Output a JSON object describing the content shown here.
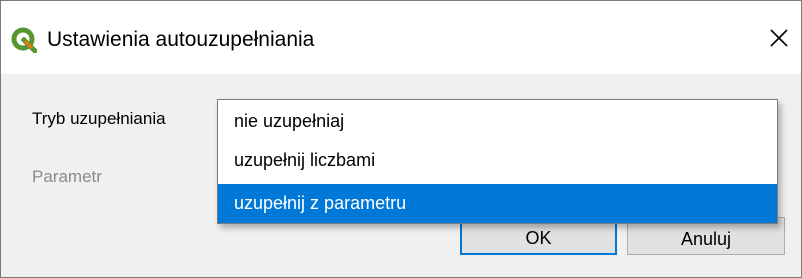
{
  "window": {
    "title": "Ustawienia autouzupełniania",
    "icon": "qgis-logo-icon",
    "close_icon": "close-icon"
  },
  "form": {
    "mode_label": "Tryb uzupełniania",
    "param_label": "Parametr"
  },
  "dropdown": {
    "options": [
      "nie uzupełniaj",
      "uzupełnij liczbami",
      "uzupełnij z parametru"
    ],
    "highlighted": "uzupełnij z parametru"
  },
  "buttons": {
    "ok": "OK",
    "cancel": "Anuluj"
  },
  "colors": {
    "accent": "#0078d7",
    "qgis_green": "#589632",
    "qgis_yellow": "#ee7913"
  }
}
